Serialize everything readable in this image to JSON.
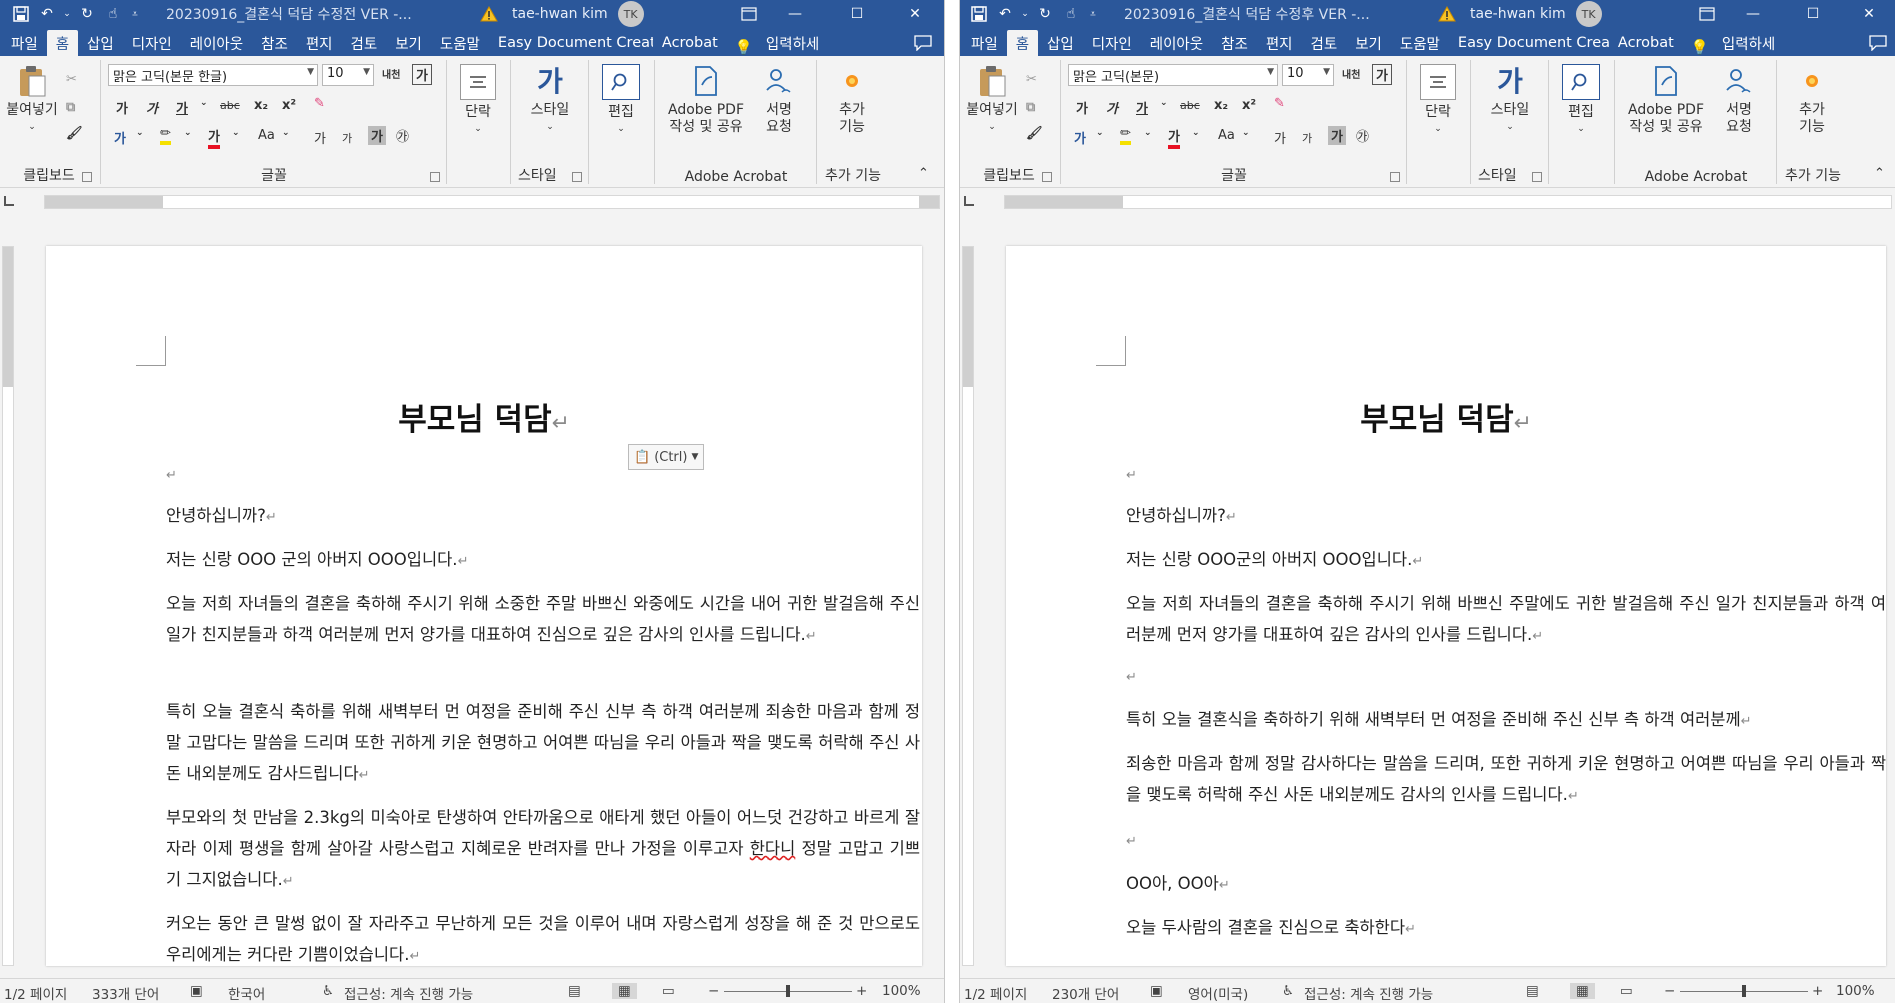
{
  "windows": {
    "left": {
      "title": "20230916_결혼식 덕담 수정전 VER  -...",
      "user": "tae-hwan kim",
      "avatar": "TK",
      "font_name": "맑은 고딕(본문 한글)",
      "font_size": "10",
      "doc": {
        "title": "부모님 덕담",
        "paragraphs": [
          "안녕하십니까?",
          "저는 신랑 OOO 군의 아버지 OOO입니다.",
          "오늘 저희 자녀들의 결혼을 축하해 주시기 위해 소중한 주말 바쁘신 와중에도 시간을 내어 귀한 발걸음해 주신 일가 친지분들과 하객 여러분께 먼저 양가를 대표하여 진심으로 깊은 감사의 인사를 드립니다.",
          "특히 오늘 결혼식 축하를 위해 새벽부터 먼 여정을 준비해 주신 신부 측 하객 여러분께 죄송한 마음과 함께 정말 고맙다는 말씀을 드리며 또한 귀하게 키운 현명하고 어여쁜 따님을 우리 아들과 짝을 맺도록 허락해 주신 사돈 내외분께도 감사드립니다",
          "부모와의 첫 만남을 2.3kg의 미숙아로 탄생하여 안타까움으로 애타게 했던 아들이 어느덧 건강하고 바르게 잘 자라 이제 평생을 함께 살아갈 사랑스럽고 지혜로운 반려자를 만나 가정을 이루고자",
          "한다니",
          "정말 고맙고 기쁘기 그지없습니다.",
          "커오는 동안 큰 말썽 없이 잘 자라주고 무난하게 모든 것을 이루어 내며 자랑스럽게 성장을 해 준 것 만으로도 우리에게는 커다란 기쁨이었습니다."
        ],
        "paste_tag": "(Ctrl)"
      },
      "status": {
        "page": "1/2 페이지",
        "words": "333개 단어",
        "lang": "한국어",
        "access": "접근성: 계속 진행 가능",
        "zoom": "100%"
      }
    },
    "right": {
      "title": "20230916_결혼식 덕담 수정후 VER  -...",
      "user": "tae-hwan kim",
      "avatar": "TK",
      "font_name": "맑은 고딕(본문)",
      "font_size": "10",
      "doc": {
        "title": "부모님 덕담",
        "paragraphs": [
          "안녕하십니까?",
          "저는 신랑 OOO군의 아버지 OOO입니다.",
          "오늘 저희 자녀들의 결혼을 축하해 주시기 위해 바쁘신 주말에도 귀한 발걸음해 주신 일가 친지분들과 하객 여러분께 먼저 양가를 대표하여 깊은 감사의 인사를 드립니다.",
          "특히 오늘 결혼식을 축하하기 위해 새벽부터 먼 여정을 준비해 주신 신부 측 하객 여러분께",
          "죄송한 마음과 함께 정말 감사하다는 말씀을 드리며, 또한 귀하게 키운 현명하고 어여쁜 따님을 우리 아들과 짝을 맺도록 허락해 주신 사돈 내외분께도 감사의 인사를 드립니다.",
          "OO아, OO아",
          "오늘 두사람의 결혼을 진심으로 축하한다"
        ]
      },
      "status": {
        "page": "1/2 페이지",
        "words": "230개 단어",
        "lang": "영어(미국)",
        "access": "접근성: 계속 진행 가능",
        "zoom": "100%"
      }
    }
  },
  "tabs": [
    "파일",
    "홈",
    "삽입",
    "디자인",
    "레이아웃",
    "참조",
    "편지",
    "검토",
    "보기",
    "도움말",
    "Easy Document Creator",
    "Acrobat",
    "입력하세"
  ],
  "ribbon": {
    "paste": "붙여넣기",
    "clipboard": "클립보드",
    "font_group": "글꼴",
    "paragraph": "단락",
    "styles": "스타일",
    "styles_group": "스타일",
    "edit": "편집",
    "adobe_pdf_1": "Adobe PDF",
    "adobe_pdf_2": "작성 및 공유",
    "sign_1": "서명",
    "sign_2": "요청",
    "acrobat_group": "Adobe Acrobat",
    "addins_1": "추가",
    "addins_2": "기능",
    "addins_group": "추가 기능",
    "bold": "가",
    "italic": "가",
    "underline": "가",
    "strike": "abc",
    "sub": "x₂",
    "sup": "x²",
    "case": "Aa",
    "grow": "가",
    "shrink": "가",
    "phonetic": "내천",
    "charbox": "가",
    "enclose": "㉮"
  },
  "colors": {
    "titlebar": "#2b579a",
    "accent": "#2b579a",
    "highlight": "#f5e000",
    "fontcolor": "#e81123"
  }
}
